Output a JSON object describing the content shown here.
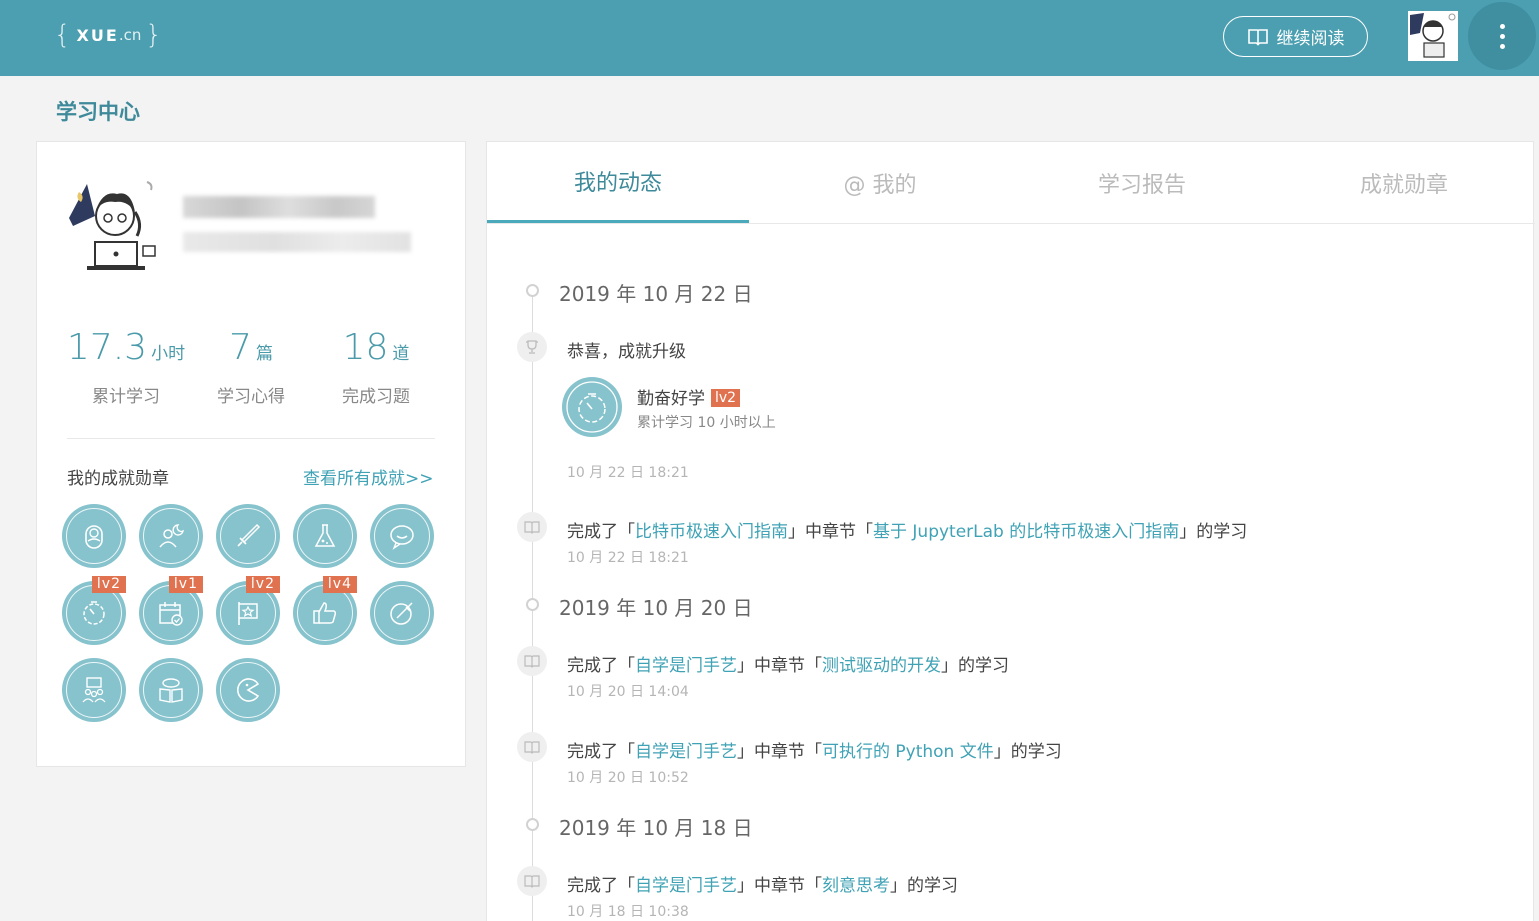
{
  "header": {
    "logo_brace_open": "{",
    "logo_main": "XUE",
    "logo_dot_cn": ".cn",
    "logo_brace_close": "}",
    "continue_label": "继续阅读",
    "accent": "#4b9fb0"
  },
  "page_title": "学习中心",
  "profile": {
    "stats": [
      {
        "num": "17.3",
        "unit": "小时",
        "label": "累计学习"
      },
      {
        "num": "7",
        "unit": "篇",
        "label": "学习心得"
      },
      {
        "num": "18",
        "unit": "道",
        "label": "完成习题"
      }
    ],
    "badges_title": "我的成就勋章",
    "badges_link": "查看所有成就>>",
    "badges": [
      {
        "icon": "baby-icon",
        "level": ""
      },
      {
        "icon": "night-person-icon",
        "level": ""
      },
      {
        "icon": "sword-icon",
        "level": ""
      },
      {
        "icon": "flask-icon",
        "level": ""
      },
      {
        "icon": "chat-smile-icon",
        "level": ""
      },
      {
        "icon": "timer-icon",
        "level": "lv2"
      },
      {
        "icon": "calendar-check-icon",
        "level": "lv1"
      },
      {
        "icon": "star-flag-icon",
        "level": "lv2"
      },
      {
        "icon": "thumbs-up-icon",
        "level": "lv4"
      },
      {
        "icon": "pen-nib-icon",
        "level": ""
      },
      {
        "icon": "group-icon",
        "level": ""
      },
      {
        "icon": "book-chat-icon",
        "level": ""
      },
      {
        "icon": "pacman-icon",
        "level": ""
      }
    ]
  },
  "tabs": [
    "我的动态",
    "@ 我的",
    "学习报告",
    "成就勋章"
  ],
  "timeline": {
    "dates": [
      "2019 年 10 月 22 日",
      "2019 年 10 月 20 日",
      "2019 年 10 月 18 日"
    ],
    "achievement": {
      "heading": "恭喜，成就升级",
      "name": "勤奋好学",
      "level": "lv2",
      "desc": "累计学习 10 小时以上",
      "time": "10 月 22 日 18:21"
    },
    "entries": [
      {
        "prefix": "完成了「",
        "course": "比特币极速入门指南",
        "mid": "」中章节「",
        "chapter": "基于 JupyterLab 的比特币极速入门指南",
        "suffix": "」的学习",
        "time": "10 月 22 日 18:21"
      },
      {
        "prefix": "完成了「",
        "course": "自学是门手艺",
        "mid": "」中章节「",
        "chapter": "测试驱动的开发",
        "suffix": "」的学习",
        "time": "10 月 20 日 14:04"
      },
      {
        "prefix": "完成了「",
        "course": "自学是门手艺",
        "mid": "」中章节「",
        "chapter": "可执行的 Python 文件",
        "suffix": "」的学习",
        "time": "10 月 20 日 10:52"
      },
      {
        "prefix": "完成了「",
        "course": "自学是门手艺",
        "mid": "」中章节「",
        "chapter": "刻意思考",
        "suffix": "」的学习",
        "time": "10 月 18 日 10:38"
      }
    ]
  }
}
